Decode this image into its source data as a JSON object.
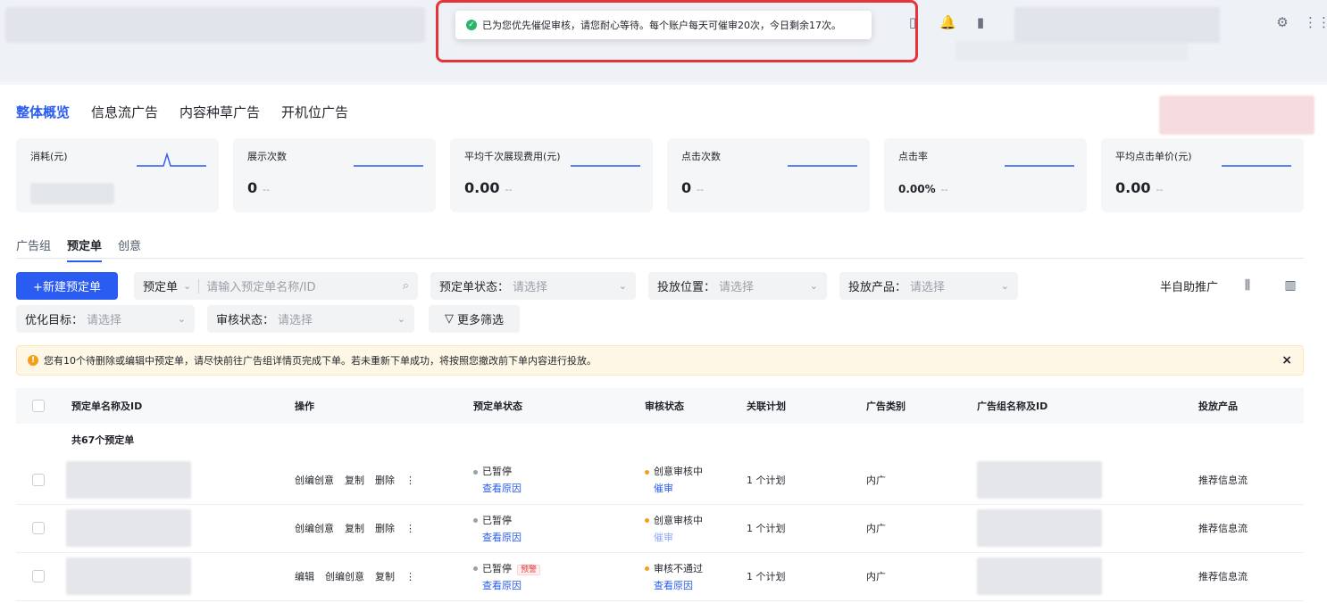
{
  "toast": {
    "message": "已为您优先催促审核，请您耐心等待。每个账户每天可催审20次，今日剩余17次。"
  },
  "colors": {
    "accent": "#2a5cf1",
    "highlight": "#e5343a",
    "success": "#2bb56b",
    "warning": "#f29f1b"
  },
  "top_tabs": [
    {
      "label": "整体概览",
      "active": true
    },
    {
      "label": "信息流广告",
      "active": false
    },
    {
      "label": "内容种草广告",
      "active": false
    },
    {
      "label": "开机位广告",
      "active": false
    }
  ],
  "metrics": [
    {
      "label": "消耗(元)",
      "value": "",
      "dash": ""
    },
    {
      "label": "展示次数",
      "value": "0",
      "dash": "--"
    },
    {
      "label": "平均千次展现费用(元)",
      "value": "0.00",
      "dash": "--"
    },
    {
      "label": "点击次数",
      "value": "0",
      "dash": "--"
    },
    {
      "label": "点击率",
      "value": "0.00%",
      "dash": "--"
    },
    {
      "label": "平均点击单价(元)",
      "value": "0.00",
      "dash": "--"
    }
  ],
  "sub_tabs": [
    {
      "label": "广告组",
      "active": false
    },
    {
      "label": "预定单",
      "active": true
    },
    {
      "label": "创意",
      "active": false
    }
  ],
  "toolbar": {
    "new_button": "+新建预定单",
    "search_type": "预定单",
    "search_placeholder": "请输入预定单名称/ID",
    "status_label": "预定单状态：",
    "status_ph": "请选择",
    "position_label": "投放位置：",
    "position_ph": "请选择",
    "product_label": "投放产品：",
    "product_ph": "请选择",
    "goal_label": "优化目标：",
    "goal_ph": "请选择",
    "review_label": "审核状态：",
    "review_ph": "请选择",
    "more_filter": "更多筛选",
    "semi_auto": "半自助推广"
  },
  "notice": {
    "text": "您有10个待删除或编辑中预定单，请尽快前往广告组详情页完成下单。若未重新下单成功，将按照您撤改前下单内容进行投放。",
    "close": "×"
  },
  "table": {
    "headers": [
      "预定单名称及ID",
      "操作",
      "预定单状态",
      "审核状态",
      "关联计划",
      "广告类别",
      "广告组名称及ID",
      "投放产品"
    ],
    "count_text": "共67个预定单",
    "rows": [
      {
        "ops": [
          "创编创意",
          "复制",
          "删除",
          "⋮"
        ],
        "status": "已暂停",
        "status_link": "查看原因",
        "status_tag": "",
        "review": "创意审核中",
        "review_link": "催审",
        "review_link_light": false,
        "plan": "1 个计划",
        "category": "内广",
        "product": "推荐信息流"
      },
      {
        "ops": [
          "创编创意",
          "复制",
          "删除",
          "⋮"
        ],
        "status": "已暂停",
        "status_link": "查看原因",
        "status_tag": "",
        "review": "创意审核中",
        "review_link": "催审",
        "review_link_light": true,
        "plan": "1 个计划",
        "category": "内广",
        "product": "推荐信息流"
      },
      {
        "ops": [
          "编辑",
          "创编创意",
          "复制",
          "⋮"
        ],
        "status": "已暂停",
        "status_link": "查看原因",
        "status_tag": "预警",
        "review": "审核不通过",
        "review_link": "查看原因",
        "review_link_light": false,
        "plan": "1 个计划",
        "category": "内广",
        "product": "推荐信息流"
      }
    ]
  }
}
